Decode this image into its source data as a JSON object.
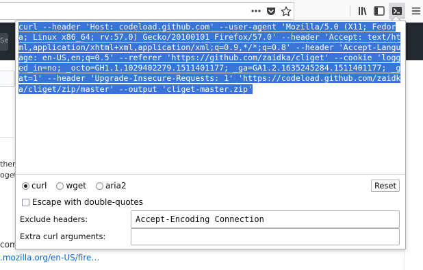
{
  "toolbar": {
    "icons": [
      "more-actions-icon",
      "pocket-icon",
      "bookmark-star-icon",
      "library-icon",
      "sidebar-icon",
      "curl-extension-icon",
      "menu-icon"
    ]
  },
  "page": {
    "search_fragment": "Sea",
    "left_text_1": "ther",
    "left_text_2": "oget",
    "left_text_3": "com",
    "link_text": ".mozilla.org/en-US/fire…",
    "link_color": "#0366d6",
    "header_color": "#24292e"
  },
  "popup": {
    "command": "curl --header 'Host: codeload.github.com' --user-agent 'Mozilla/5.0 (X11; Fedora; Linux x86_64; rv:57.0) Gecko/20100101 Firefox/57.0' --header 'Accept: text/html,application/xhtml+xml,application/xml;q=0.9,*/*;q=0.8' --header 'Accept-Language: en-US,en;q=0.5' --referer 'https://github.com/zaidka/cliget' --cookie 'logged_in=no; _octo=GH1.1.1029402279.1511401177; _ga=GA1.2.1635245284.1511401177; _gat=1' --header 'Upgrade-Insecure-Requests: 1' 'https://codeload.github.com/zaidka/cliget/zip/master' --output 'cliget-master.zip'",
    "selection_color": "#3875d7",
    "tools": [
      {
        "label": "curl",
        "selected": true
      },
      {
        "label": "wget",
        "selected": false
      },
      {
        "label": "aria2",
        "selected": false
      }
    ],
    "reset_label": "Reset",
    "escape_label": "Escape with double-quotes",
    "escape_checked": false,
    "exclude_headers_label": "Exclude headers:",
    "exclude_headers_value": "Accept-Encoding Connection",
    "extra_args_label": "Extra curl arguments:",
    "extra_args_value": ""
  }
}
